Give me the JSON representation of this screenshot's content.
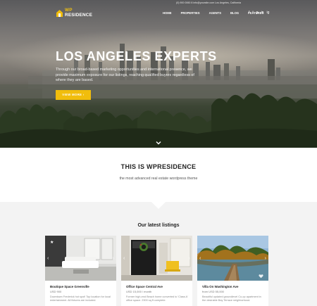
{
  "brand": {
    "line1": "WP",
    "line2": "RESIDENCE"
  },
  "contact": "(0) 900 0060 8  info@yoursite.com  Los Angeles, California",
  "nav": [
    "HOME",
    "PROPERTIES",
    "AGENTS",
    "BLOG",
    "FEATURES"
  ],
  "social": [
    "f",
    "t",
    "p",
    "in",
    "ig"
  ],
  "hero": {
    "title": "LOS ANGELES EXPERTS",
    "description": "Through our broad-based marketing opportunities and international presence, we provide maximum exposure for our listings, reaching qualified buyers regardless of where they are based.",
    "button": "VIEW MORE"
  },
  "about": {
    "title": "THIS IS WPRESIDENCE",
    "subtitle": "the most advanced real estate wordpress theme"
  },
  "listings": {
    "title": "Our latest listings",
    "items": [
      {
        "name": "Boutique Space Greenville",
        "price": "USD 900",
        "desc": "Downtown Frederick hot spot! Top location for local entertainment. All fixtures are included."
      },
      {
        "name": "Office Space Central Ave",
        "price": "USD 15,000 / month",
        "desc": "Former high-end Beach home converted to 'Class A' office space. 2300 sq ft complete."
      },
      {
        "name": "Villa On Washington Ave",
        "price": "from USD 55,000",
        "desc": "Beautiful updated groundlevel Co-op apartment in the desirable Bay Terrace neighborhood."
      }
    ]
  },
  "colors": {
    "accent": "#f1bd0c",
    "heading": "#222222",
    "section_bg": "#f3f3f3"
  }
}
